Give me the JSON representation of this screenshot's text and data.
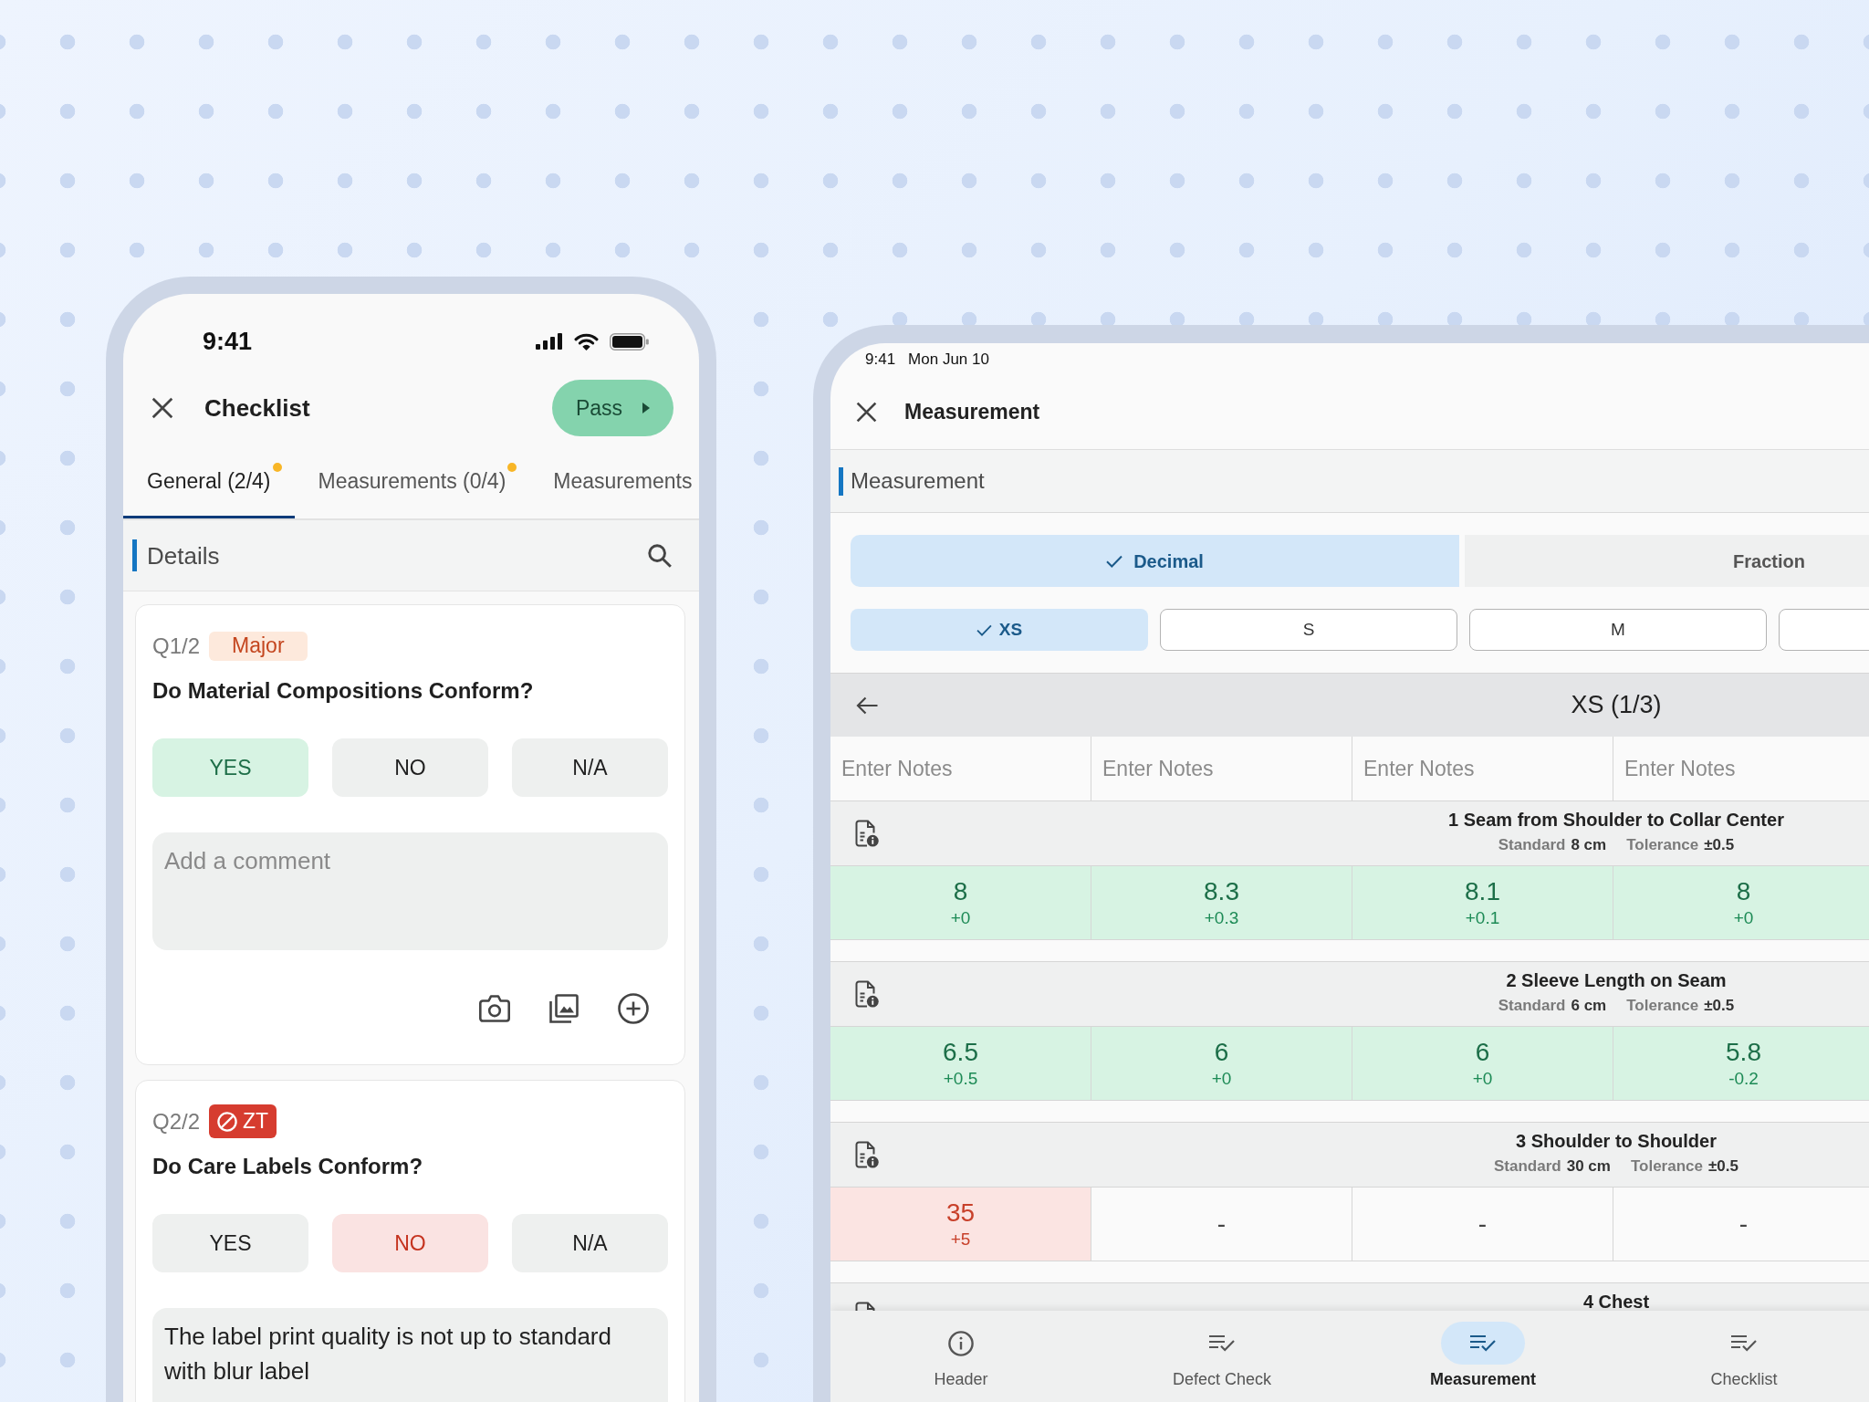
{
  "phone": {
    "status_bar": {
      "time": "9:41"
    },
    "header": {
      "title": "Checklist",
      "action": "Pass"
    },
    "tabs": [
      {
        "label": "General (2/4)",
        "selected": true,
        "indicator": true
      },
      {
        "label": "Measurements (0/4)",
        "selected": false,
        "indicator": true
      },
      {
        "label": "Measurements",
        "selected": false,
        "indicator": false
      }
    ],
    "section": {
      "title": "Details"
    },
    "questions": [
      {
        "number": "Q1/2",
        "badge": {
          "kind": "major",
          "label": "Major"
        },
        "text": "Do Material Compositions Conform?",
        "answers": [
          {
            "kind": "yes",
            "label": "YES",
            "selected": true
          },
          {
            "kind": "no",
            "label": "NO",
            "selected": false
          },
          {
            "kind": "na",
            "label": "N/A",
            "selected": false
          }
        ],
        "comment": {
          "placeholder": "Add a comment"
        },
        "media_buttons": true
      },
      {
        "number": "Q2/2",
        "badge": {
          "kind": "zero_tolerance",
          "label": "ZT"
        },
        "text": "Do Care Labels Conform?",
        "answers": [
          {
            "kind": "yes",
            "label": "YES",
            "selected": false
          },
          {
            "kind": "no",
            "label": "NO",
            "selected": true
          },
          {
            "kind": "na",
            "label": "N/A",
            "selected": false
          }
        ],
        "comment": {
          "value": "The label print quality is not up to standard with blur label"
        }
      }
    ]
  },
  "tablet": {
    "status_bar": {
      "time": "9:41",
      "date": "Mon Jun 10"
    },
    "header": {
      "title": "Measurement"
    },
    "section": {
      "title": "Measurement"
    },
    "units": [
      {
        "label": "Decimal",
        "selected": true
      },
      {
        "label": "Fraction",
        "selected": false
      }
    ],
    "sizes": [
      {
        "label": "XS",
        "selected": true
      },
      {
        "label": "S",
        "selected": false
      },
      {
        "label": "M",
        "selected": false
      },
      {
        "selected": false
      }
    ],
    "size_header": {
      "title": "XS (1/3)"
    },
    "notes": [
      {
        "placeholder": "Enter Notes"
      },
      {
        "placeholder": "Enter Notes"
      },
      {
        "placeholder": "Enter Notes"
      },
      {
        "placeholder": "Enter Notes"
      }
    ],
    "measurements": [
      {
        "title": "1 Seam from Shoulder to Collar Center",
        "standard": {
          "label": "Standard",
          "value": "8 cm"
        },
        "tolerance": {
          "label": "Tolerance",
          "value": "±0.5"
        },
        "readings": [
          {
            "kind": "pass",
            "value": "8",
            "deviation": "+0"
          },
          {
            "kind": "pass",
            "value": "8.3",
            "deviation": "+0.3"
          },
          {
            "kind": "pass",
            "value": "8.1",
            "deviation": "+0.1"
          },
          {
            "kind": "pass",
            "value": "8",
            "deviation": "+0"
          }
        ]
      },
      {
        "title": "2 Sleeve Length on Seam",
        "standard": {
          "label": "Standard",
          "value": "6 cm"
        },
        "tolerance": {
          "label": "Tolerance",
          "value": "±0.5"
        },
        "readings": [
          {
            "kind": "pass",
            "value": "6.5",
            "deviation": "+0.5"
          },
          {
            "kind": "pass",
            "value": "6",
            "deviation": "+0"
          },
          {
            "kind": "pass",
            "value": "6",
            "deviation": "+0"
          },
          {
            "kind": "pass",
            "value": "5.8",
            "deviation": "-0.2"
          }
        ]
      },
      {
        "title": "3 Shoulder to Shoulder",
        "standard": {
          "label": "Standard",
          "value": "30 cm"
        },
        "tolerance": {
          "label": "Tolerance",
          "value": "±0.5"
        },
        "readings": [
          {
            "kind": "fail",
            "value": "35",
            "deviation": "+5"
          },
          {
            "kind": "empty",
            "value": "-"
          },
          {
            "kind": "empty",
            "value": "-"
          },
          {
            "kind": "empty",
            "value": "-"
          }
        ]
      },
      {
        "title": "4 Chest"
      }
    ],
    "nav": [
      {
        "kind": "info",
        "label": "Header",
        "selected": false
      },
      {
        "kind": "checklist",
        "label": "Defect Check",
        "selected": false
      },
      {
        "kind": "checklist",
        "label": "Measurement",
        "selected": true
      },
      {
        "kind": "checklist",
        "label": "Checklist",
        "selected": false
      }
    ]
  }
}
